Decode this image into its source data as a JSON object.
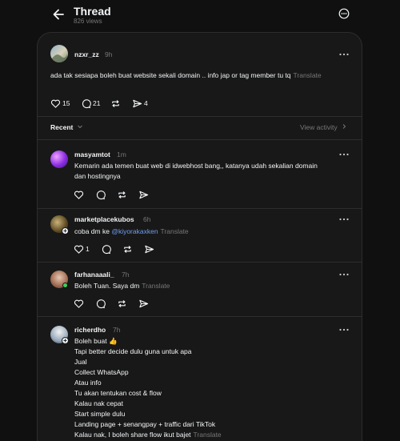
{
  "header": {
    "title": "Thread",
    "views": "826 views"
  },
  "original_post": {
    "username": "nzxr_zz",
    "time": "9h",
    "text": "ada tak sesiapa boleh buat website sekali domain .. info jap or tag member tu tq",
    "translate": "Translate",
    "likes": "15",
    "replies": "21",
    "shares": "4"
  },
  "filter": {
    "label": "Recent",
    "view_activity": "View activity"
  },
  "replies": [
    {
      "username": "masyamtot",
      "time": "1m",
      "line1": "Kemarin ada temen buat web di idwebhost bang,, katanya udah sekalian domain",
      "line2": "dan hostingnya"
    },
    {
      "username": "marketplacekubos",
      "time": "6h",
      "text_prefix": "coba dm ke ",
      "mention": "@kiyorakaxken",
      "translate": "Translate",
      "likes": "1"
    },
    {
      "username": "farhanaaali_",
      "time": "7h",
      "text": "Boleh Tuan. Saya dm",
      "translate": "Translate"
    },
    {
      "username": "richerdho",
      "time": "7h",
      "lines": [
        "Boleh buat 👍",
        "Tapi better decide dulu guna untuk apa",
        "Jual",
        "Collect WhatsApp",
        "Atau info",
        "Tu akan tentukan cost & flow",
        "Kalau nak cepat",
        "Start simple dulu",
        "Landing page + senangpay + traffic dari TikTok",
        "Kalau nak, I boleh share flow ikut bajet"
      ],
      "translate": "Translate"
    }
  ],
  "colors": {
    "background": "#101010",
    "card": "#181818",
    "text": "#f3f5f7",
    "muted": "#777777",
    "mention": "#6f9ef2",
    "online": "#3fcf5b"
  }
}
